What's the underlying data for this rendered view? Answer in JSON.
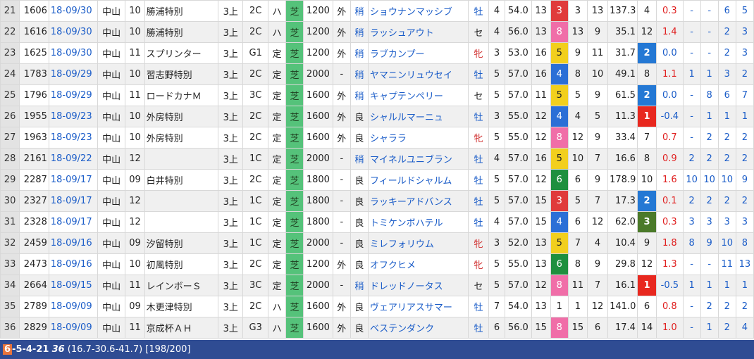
{
  "colors": {
    "gate1": "#ffffff",
    "gate2": "#222222",
    "gate3": "#e03b3b",
    "gate4": "#2b6fd6",
    "gate5": "#f2cf1d",
    "gate6": "#1e8f3e",
    "gate7": "#f28c28",
    "gate8": "#f06ea8",
    "rank1": "#e8281f",
    "rank2": "#2478d4",
    "rank3": "#4b7a2a",
    "surface": "#55c27a",
    "footer_bg": "#2f4c93"
  },
  "rows": [
    {
      "idx": "21",
      "rid": "1606",
      "date": "18-09/30",
      "track": "中山",
      "race": "10",
      "name": "勝浦特別",
      "age": "3上",
      "cls": "2C",
      "h": "ハ",
      "surf": "芝",
      "dist": "1200",
      "course": "外",
      "cond": "稍",
      "horse": "ショウナンマッシブ",
      "sex": "牡",
      "hage": "4",
      "wt": "54.0",
      "field": "13",
      "gate": "3",
      "post": "3",
      "pop": "13",
      "odds": "137.3",
      "rank": "4",
      "diff": "0.3",
      "p1": "-",
      "p2": "-",
      "p3": "6",
      "p4": "5"
    },
    {
      "idx": "22",
      "rid": "1616",
      "date": "18-09/30",
      "track": "中山",
      "race": "10",
      "name": "勝浦特別",
      "age": "3上",
      "cls": "2C",
      "h": "ハ",
      "surf": "芝",
      "dist": "1200",
      "course": "外",
      "cond": "稍",
      "horse": "ラッシュアウト",
      "sex": "セ",
      "hage": "4",
      "wt": "56.0",
      "field": "13",
      "gate": "8",
      "post": "13",
      "pop": "9",
      "odds": "35.1",
      "rank": "12",
      "diff": "1.4",
      "p1": "-",
      "p2": "-",
      "p3": "2",
      "p4": "3"
    },
    {
      "idx": "23",
      "rid": "1625",
      "date": "18-09/30",
      "track": "中山",
      "race": "11",
      "name": "スプリンター",
      "age": "3上",
      "cls": "G1",
      "h": "定",
      "surf": "芝",
      "dist": "1200",
      "course": "外",
      "cond": "稍",
      "horse": "ラブカンプー",
      "sex": "牝",
      "hage": "3",
      "wt": "53.0",
      "field": "16",
      "gate": "5",
      "post": "9",
      "pop": "11",
      "odds": "31.7",
      "rank": "2",
      "diff": "0.0",
      "p1": "-",
      "p2": "-",
      "p3": "2",
      "p4": "3"
    },
    {
      "idx": "24",
      "rid": "1783",
      "date": "18-09/29",
      "track": "中山",
      "race": "10",
      "name": "習志野特別",
      "age": "3上",
      "cls": "2C",
      "h": "定",
      "surf": "芝",
      "dist": "2000",
      "course": "-",
      "cond": "稍",
      "horse": "ヤマニンリュウセイ",
      "sex": "牡",
      "hage": "5",
      "wt": "57.0",
      "field": "16",
      "gate": "4",
      "post": "8",
      "pop": "10",
      "odds": "49.1",
      "rank": "8",
      "diff": "1.1",
      "p1": "1",
      "p2": "1",
      "p3": "3",
      "p4": "2"
    },
    {
      "idx": "25",
      "rid": "1796",
      "date": "18-09/29",
      "track": "中山",
      "race": "11",
      "name": "ロードカナＭ",
      "age": "3上",
      "cls": "3C",
      "h": "定",
      "surf": "芝",
      "dist": "1600",
      "course": "外",
      "cond": "稍",
      "horse": "キャプテンペリー",
      "sex": "セ",
      "hage": "5",
      "wt": "57.0",
      "field": "11",
      "gate": "5",
      "post": "5",
      "pop": "9",
      "odds": "61.5",
      "rank": "2",
      "diff": "0.0",
      "p1": "-",
      "p2": "8",
      "p3": "6",
      "p4": "7"
    },
    {
      "idx": "26",
      "rid": "1955",
      "date": "18-09/23",
      "track": "中山",
      "race": "10",
      "name": "外房特別",
      "age": "3上",
      "cls": "2C",
      "h": "定",
      "surf": "芝",
      "dist": "1600",
      "course": "外",
      "cond": "良",
      "horse": "シャルルマーニュ",
      "sex": "牡",
      "hage": "3",
      "wt": "55.0",
      "field": "12",
      "gate": "4",
      "post": "4",
      "pop": "5",
      "odds": "11.3",
      "rank": "1",
      "diff": "-0.4",
      "p1": "-",
      "p2": "1",
      "p3": "1",
      "p4": "1"
    },
    {
      "idx": "27",
      "rid": "1963",
      "date": "18-09/23",
      "track": "中山",
      "race": "10",
      "name": "外房特別",
      "age": "3上",
      "cls": "2C",
      "h": "定",
      "surf": "芝",
      "dist": "1600",
      "course": "外",
      "cond": "良",
      "horse": "シャララ",
      "sex": "牝",
      "hage": "5",
      "wt": "55.0",
      "field": "12",
      "gate": "8",
      "post": "12",
      "pop": "9",
      "odds": "33.4",
      "rank": "7",
      "diff": "0.7",
      "p1": "-",
      "p2": "2",
      "p3": "2",
      "p4": "2"
    },
    {
      "idx": "28",
      "rid": "2161",
      "date": "18-09/22",
      "track": "中山",
      "race": "12",
      "name": "",
      "age": "3上",
      "cls": "1C",
      "h": "定",
      "surf": "芝",
      "dist": "2000",
      "course": "-",
      "cond": "稍",
      "horse": "マイネルユニブラン",
      "sex": "牡",
      "hage": "4",
      "wt": "57.0",
      "field": "16",
      "gate": "5",
      "post": "10",
      "pop": "7",
      "odds": "16.6",
      "rank": "8",
      "diff": "0.9",
      "p1": "2",
      "p2": "2",
      "p3": "2",
      "p4": "2"
    },
    {
      "idx": "29",
      "rid": "2287",
      "date": "18-09/17",
      "track": "中山",
      "race": "09",
      "name": "白井特別",
      "age": "3上",
      "cls": "2C",
      "h": "定",
      "surf": "芝",
      "dist": "1800",
      "course": "-",
      "cond": "良",
      "horse": "フィールドシャルム",
      "sex": "牡",
      "hage": "5",
      "wt": "57.0",
      "field": "12",
      "gate": "6",
      "post": "6",
      "pop": "9",
      "odds": "178.9",
      "rank": "10",
      "diff": "1.6",
      "p1": "10",
      "p2": "10",
      "p3": "10",
      "p4": "9"
    },
    {
      "idx": "30",
      "rid": "2327",
      "date": "18-09/17",
      "track": "中山",
      "race": "12",
      "name": "",
      "age": "3上",
      "cls": "1C",
      "h": "定",
      "surf": "芝",
      "dist": "1800",
      "course": "-",
      "cond": "良",
      "horse": "ラッキーアドバンス",
      "sex": "牡",
      "hage": "5",
      "wt": "57.0",
      "field": "15",
      "gate": "3",
      "post": "5",
      "pop": "7",
      "odds": "17.3",
      "rank": "2",
      "diff": "0.1",
      "p1": "2",
      "p2": "2",
      "p3": "2",
      "p4": "2"
    },
    {
      "idx": "31",
      "rid": "2328",
      "date": "18-09/17",
      "track": "中山",
      "race": "12",
      "name": "",
      "age": "3上",
      "cls": "1C",
      "h": "定",
      "surf": "芝",
      "dist": "1800",
      "course": "-",
      "cond": "良",
      "horse": "トミケンボハテル",
      "sex": "牡",
      "hage": "4",
      "wt": "57.0",
      "field": "15",
      "gate": "4",
      "post": "6",
      "pop": "12",
      "odds": "62.0",
      "rank": "3",
      "diff": "0.3",
      "p1": "3",
      "p2": "3",
      "p3": "3",
      "p4": "3"
    },
    {
      "idx": "32",
      "rid": "2459",
      "date": "18-09/16",
      "track": "中山",
      "race": "09",
      "name": "汐留特別",
      "age": "3上",
      "cls": "1C",
      "h": "定",
      "surf": "芝",
      "dist": "2000",
      "course": "-",
      "cond": "良",
      "horse": "ミレフォリウム",
      "sex": "牝",
      "hage": "3",
      "wt": "52.0",
      "field": "13",
      "gate": "5",
      "post": "7",
      "pop": "4",
      "odds": "10.4",
      "rank": "9",
      "diff": "1.8",
      "p1": "8",
      "p2": "9",
      "p3": "10",
      "p4": "8"
    },
    {
      "idx": "33",
      "rid": "2473",
      "date": "18-09/16",
      "track": "中山",
      "race": "10",
      "name": "初風特別",
      "age": "3上",
      "cls": "2C",
      "h": "定",
      "surf": "芝",
      "dist": "1200",
      "course": "外",
      "cond": "良",
      "horse": "オフクヒメ",
      "sex": "牝",
      "hage": "5",
      "wt": "55.0",
      "field": "13",
      "gate": "6",
      "post": "8",
      "pop": "9",
      "odds": "29.8",
      "rank": "12",
      "diff": "1.3",
      "p1": "-",
      "p2": "-",
      "p3": "11",
      "p4": "13"
    },
    {
      "idx": "34",
      "rid": "2664",
      "date": "18-09/15",
      "track": "中山",
      "race": "11",
      "name": "レインボーＳ",
      "age": "3上",
      "cls": "3C",
      "h": "定",
      "surf": "芝",
      "dist": "2000",
      "course": "-",
      "cond": "稍",
      "horse": "ドレッドノータス",
      "sex": "セ",
      "hage": "5",
      "wt": "57.0",
      "field": "12",
      "gate": "8",
      "post": "11",
      "pop": "7",
      "odds": "16.1",
      "rank": "1",
      "diff": "-0.5",
      "p1": "1",
      "p2": "1",
      "p3": "1",
      "p4": "1"
    },
    {
      "idx": "35",
      "rid": "2789",
      "date": "18-09/09",
      "track": "中山",
      "race": "09",
      "name": "木更津特別",
      "age": "3上",
      "cls": "2C",
      "h": "ハ",
      "surf": "芝",
      "dist": "1600",
      "course": "外",
      "cond": "良",
      "horse": "ヴェアリアスサマー",
      "sex": "牡",
      "hage": "7",
      "wt": "54.0",
      "field": "13",
      "gate": "1",
      "post": "1",
      "pop": "12",
      "odds": "141.0",
      "rank": "6",
      "diff": "0.8",
      "p1": "-",
      "p2": "2",
      "p3": "2",
      "p4": "2"
    },
    {
      "idx": "36",
      "rid": "2829",
      "date": "18-09/09",
      "track": "中山",
      "race": "11",
      "name": "京成杯ＡＨ",
      "age": "3上",
      "cls": "G3",
      "h": "ハ",
      "surf": "芝",
      "dist": "1600",
      "course": "外",
      "cond": "良",
      "horse": "ベステンダンク",
      "sex": "牡",
      "hage": "6",
      "wt": "56.0",
      "field": "15",
      "gate": "8",
      "post": "15",
      "pop": "6",
      "odds": "17.4",
      "rank": "14",
      "diff": "1.0",
      "p1": "-",
      "p2": "1",
      "p3": "2",
      "p4": "4"
    }
  ],
  "footer": {
    "first": "6",
    "rest": "-5-4-21",
    "bold36": "36",
    "stats": "(16.7-30.6-41.7) [198/200]"
  }
}
